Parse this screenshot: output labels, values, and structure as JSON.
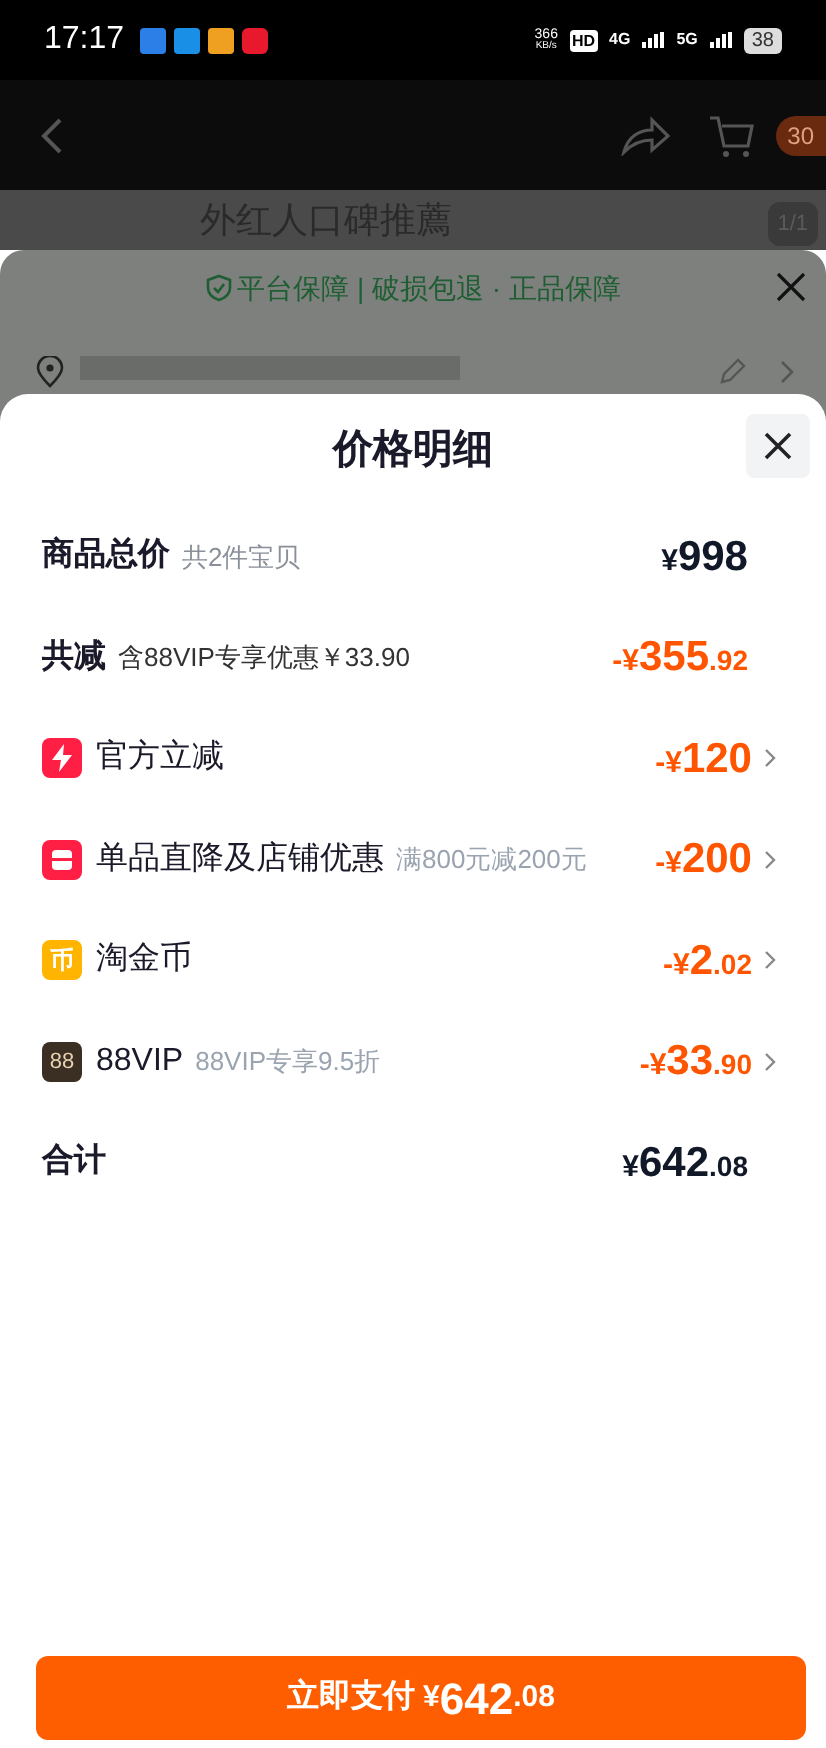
{
  "status_bar": {
    "time": "17:17",
    "speed": "366",
    "speed_unit": "KB/s",
    "hd": "HD",
    "net_4g": "4G",
    "net_5g": "5G",
    "battery": "38"
  },
  "nav": {
    "cart_badge": "30"
  },
  "banner_behind": {
    "text": "外红人口碑推薦",
    "counter": "1/1"
  },
  "guarantee": {
    "text": "平台保障 | 破损包退 · 正品保障"
  },
  "sheet": {
    "title": "价格明细",
    "rows": [
      {
        "kind": "subtotal",
        "label": "商品总价",
        "note": "共2件宝贝",
        "sign": "¥",
        "integer": "998"
      },
      {
        "kind": "reduction",
        "label": "共减",
        "note": "含88VIP专享优惠￥33.90",
        "sign": "-¥",
        "integer": "355",
        "decimal": ".92"
      },
      {
        "kind": "bolt",
        "label": "官方立减",
        "sign": "-¥",
        "integer": "120"
      },
      {
        "kind": "store",
        "label": "单品直降及店铺优惠",
        "note": "满800元减200元",
        "sign": "-¥",
        "integer": "200"
      },
      {
        "kind": "coin",
        "icon_text": "币",
        "label": "淘金币",
        "sign": "-¥",
        "integer": "2",
        "decimal": ".02"
      },
      {
        "kind": "vip",
        "icon_text": "88",
        "label": "88VIP",
        "note": "88VIP专享9.5折",
        "sign": "-¥",
        "integer": "33",
        "decimal": ".90"
      },
      {
        "kind": "total",
        "label": "合计",
        "sign": "¥",
        "integer": "642",
        "decimal": ".08"
      }
    ]
  },
  "pay_button": {
    "label": "立即支付",
    "sign": "¥",
    "integer": "642",
    "decimal": ".08"
  }
}
